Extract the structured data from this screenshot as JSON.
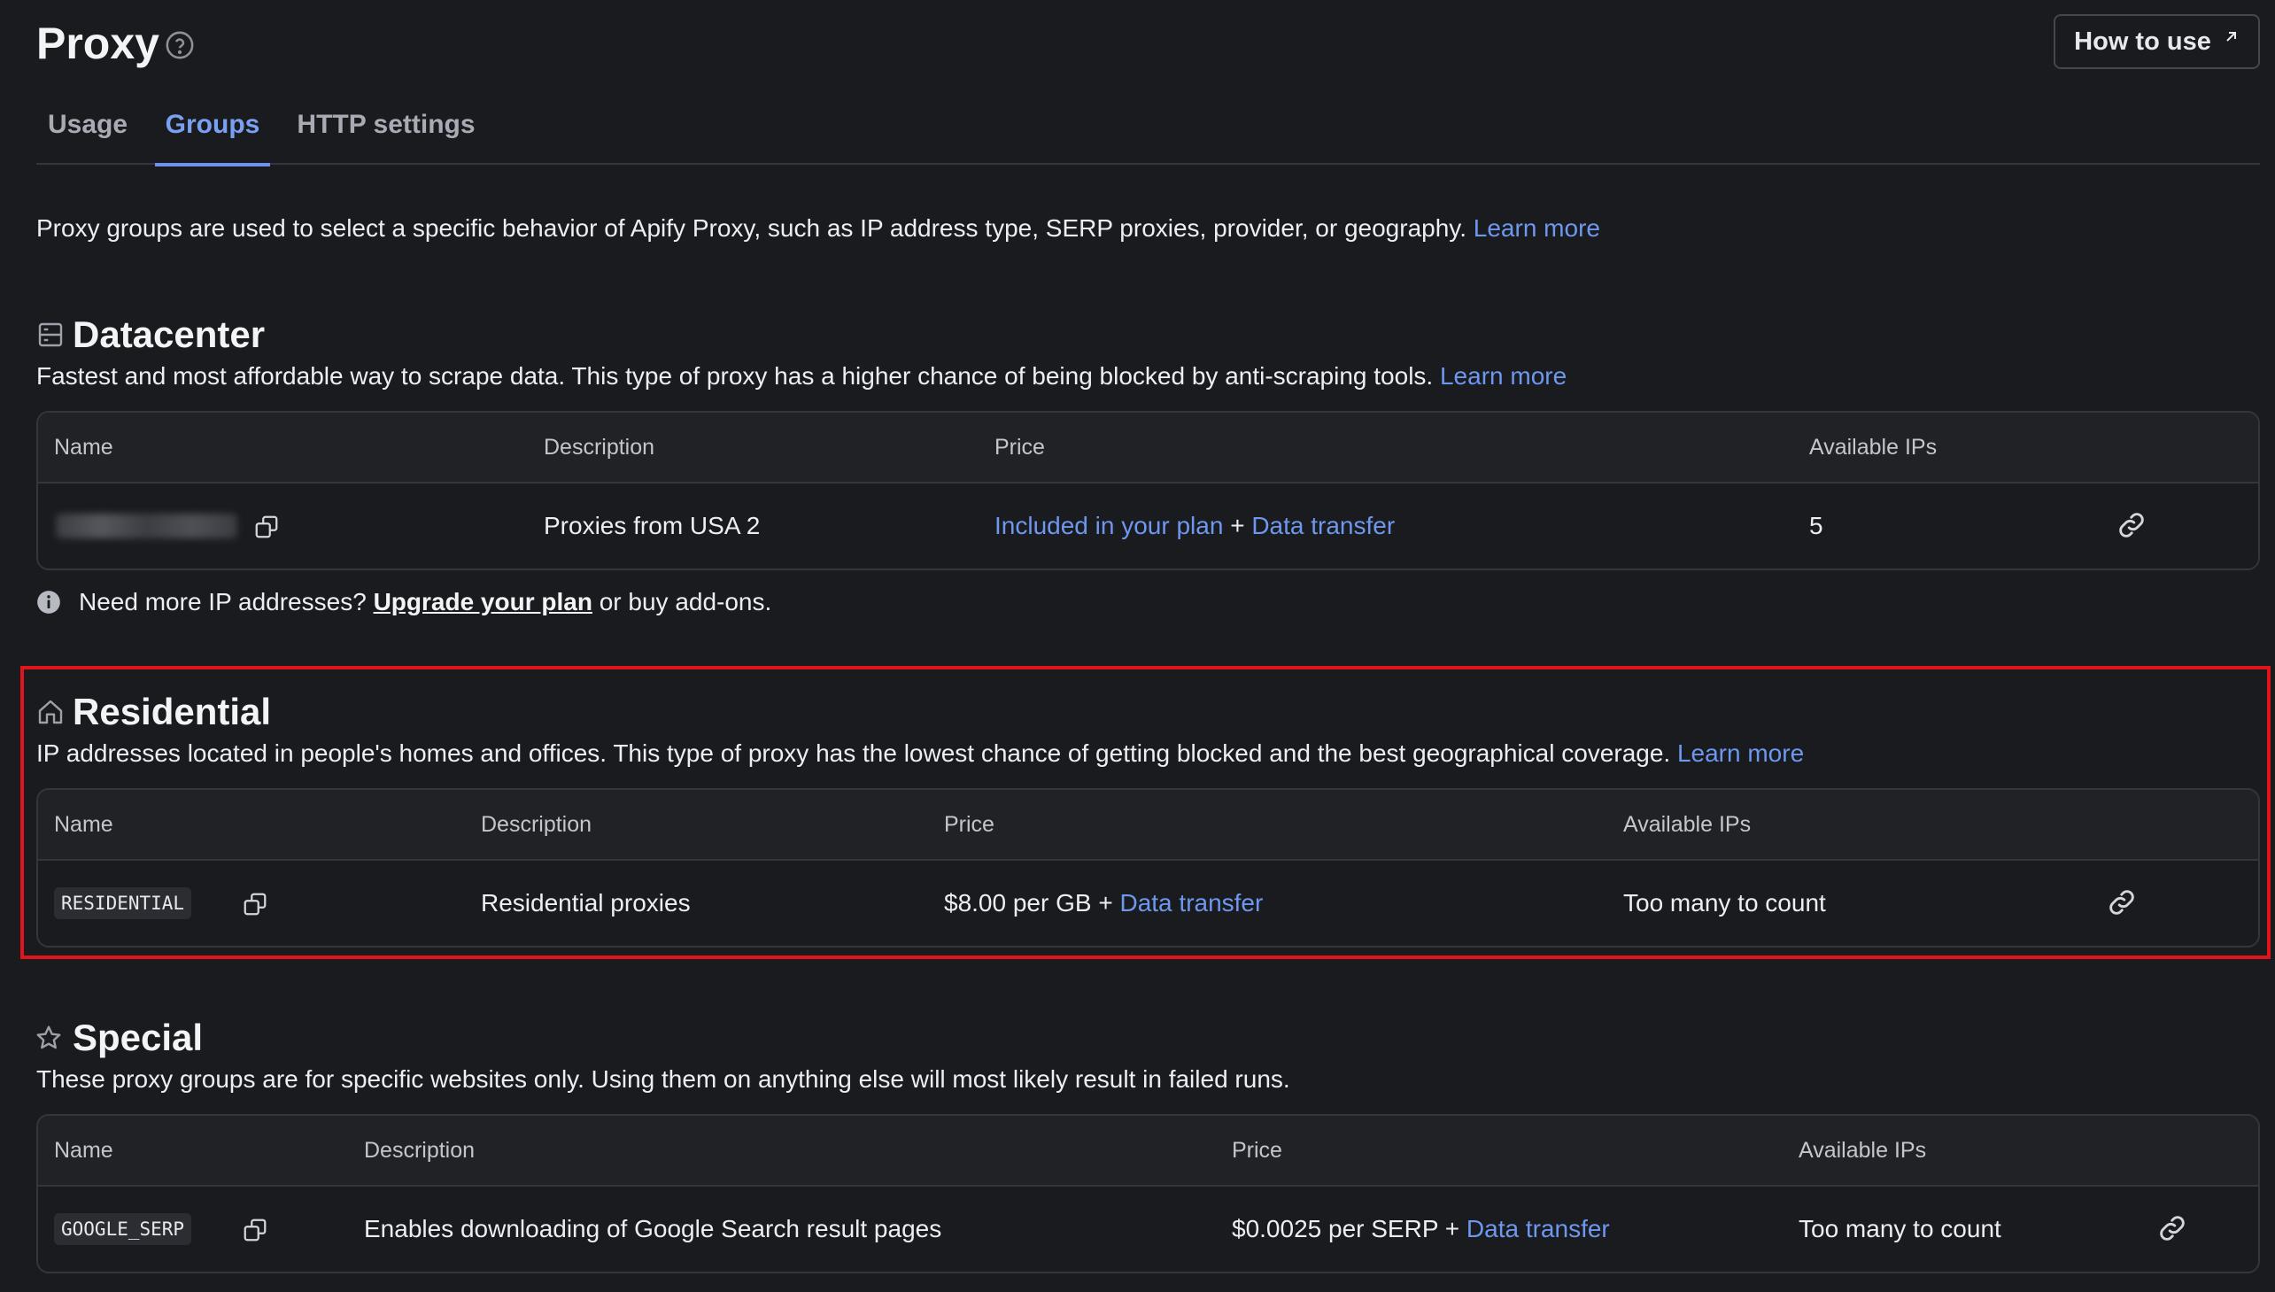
{
  "page": {
    "title": "Proxy",
    "how_to_use": "How to use"
  },
  "tabs": [
    {
      "label": "Usage",
      "active": false
    },
    {
      "label": "Groups",
      "active": true
    },
    {
      "label": "HTTP settings",
      "active": false
    }
  ],
  "intro": {
    "text": "Proxy groups are used to select a specific behavior of Apify Proxy, such as IP address type, SERP proxies, provider, or geography.",
    "link": "Learn more"
  },
  "columns": {
    "name": "Name",
    "description": "Description",
    "price": "Price",
    "available_ips": "Available IPs"
  },
  "datacenter": {
    "title": "Datacenter",
    "description": "Fastest and most affordable way to scrape data. This type of proxy has a higher chance of being blocked by anti-scraping tools.",
    "link": "Learn more",
    "row": {
      "description": "Proxies from USA 2",
      "price_link": "Included in your plan",
      "plus": "+",
      "transfer_link": "Data transfer",
      "available_ips": "5"
    },
    "notice": {
      "prefix": "Need more IP addresses?",
      "link": "Upgrade your plan",
      "suffix": "or buy add-ons."
    }
  },
  "residential": {
    "title": "Residential",
    "description": "IP addresses located in people's homes and offices. This type of proxy has the lowest chance of getting blocked and the best geographical coverage.",
    "link": "Learn more",
    "row": {
      "name": "RESIDENTIAL",
      "description": "Residential proxies",
      "price": "$8.00 per GB",
      "plus": "+",
      "transfer_link": "Data transfer",
      "available_ips": "Too many to count"
    }
  },
  "special": {
    "title": "Special",
    "description": "These proxy groups are for specific websites only. Using them on anything else will most likely result in failed runs.",
    "row": {
      "name": "GOOGLE_SERP",
      "description": "Enables downloading of Google Search result pages",
      "price": "$0.0025 per SERP",
      "plus": "+",
      "transfer_link": "Data transfer",
      "available_ips": "Too many to count"
    }
  },
  "colors": {
    "background": "#1a1b1e",
    "link": "#6e97ef",
    "highlight": "#e1141b"
  }
}
